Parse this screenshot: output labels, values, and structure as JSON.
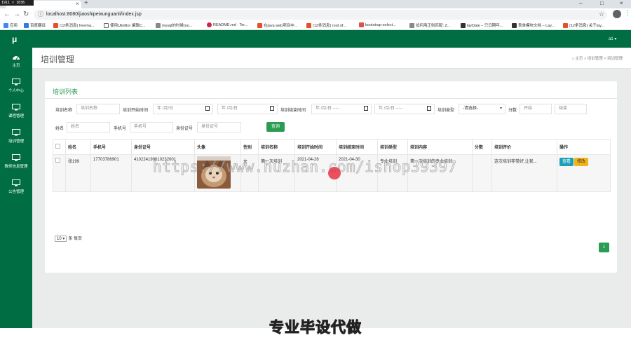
{
  "browser": {
    "corner_badge": "1911 × 1036",
    "url": "localhost:8080/jiaoshipeixunguanli/index.jsp",
    "bookmarks": [
      "应用",
      "百度翻译",
      "(12条消息) freema...",
      "使用UEditor 编辑C...",
      "mysql的时候(oo...",
      "README.md · Ter...",
      "在java web项目中...",
      "(12条消息) root of...",
      "bootstrap-select...",
      "如何用正则匹配: Z...",
      "layDate – 只日期年...",
      "表单模块文档 – Lay...",
      "(12条消息) 关于lay..."
    ]
  },
  "app": {
    "logo": "μ",
    "user_menu": "a1 ▾",
    "sidebar": [
      {
        "label": "主页",
        "icon": "dashboard-icon"
      },
      {
        "label": "个人中心",
        "icon": "monitor-icon"
      },
      {
        "label": "课程管理",
        "icon": "monitor-icon"
      },
      {
        "label": "培训管理",
        "icon": "monitor-icon"
      },
      {
        "label": "教师信息管理",
        "icon": "monitor-icon"
      },
      {
        "label": "公告管理",
        "icon": "monitor-icon"
      }
    ],
    "page_title": "培训管理",
    "breadcrumb": {
      "home": "主页",
      "parent": "培训管理",
      "current": "培训管理",
      "sep": ">"
    }
  },
  "card": {
    "title": "培训列表",
    "filters": {
      "training_name_label": "培训名称",
      "training_name_placeholder": "培训名称",
      "start_time_label": "培训开始时间",
      "date_placeholder": "年 /月/日",
      "end_time_label": "培训结束时间",
      "datetime_placeholder": "年 /月/日 --:--",
      "type_label": "培训类型",
      "type_selected": "-请选择-",
      "score_label": "分数",
      "score_start_placeholder": "开始",
      "score_end_placeholder": "结束",
      "name_label": "姓名",
      "name_placeholder": "姓名",
      "phone_label": "手机号",
      "phone_placeholder": "手机号",
      "id_label": "身份证号",
      "id_placeholder": "身份证号",
      "search_button": "查询"
    },
    "table": {
      "headers": [
        "",
        "姓名",
        "手机号",
        "身份证号",
        "头像",
        "性别",
        "培训名称",
        "培训开始时间",
        "培训结束时间",
        "培训类型",
        "培训内容",
        "分数",
        "培训评价",
        "操作"
      ],
      "rows": [
        {
          "name": "张199",
          "phone": "17703786901",
          "id_number": "410224199610232001",
          "gender": "女",
          "training_name": "第一次培训",
          "start": "2021-04-26",
          "end": "2021-04-30",
          "type": "专业培训",
          "content": "第一次培训的专业培训",
          "score": "",
          "evaluation": "这次培训非常好,让我...",
          "view_label": "查看",
          "edit_label": "修改"
        }
      ]
    },
    "page_size_value": "10 ▾",
    "page_size_suffix": "条 每页",
    "current_page": "1"
  },
  "overlay": {
    "watermark": "https://www.huzhan.com/ishop39397",
    "caption": "专业毕设代做"
  },
  "colors": {
    "brand_green": "#006e42",
    "button_green": "#2a9d52",
    "view_blue": "#1b9fb8",
    "edit_yellow": "#f2b318"
  }
}
